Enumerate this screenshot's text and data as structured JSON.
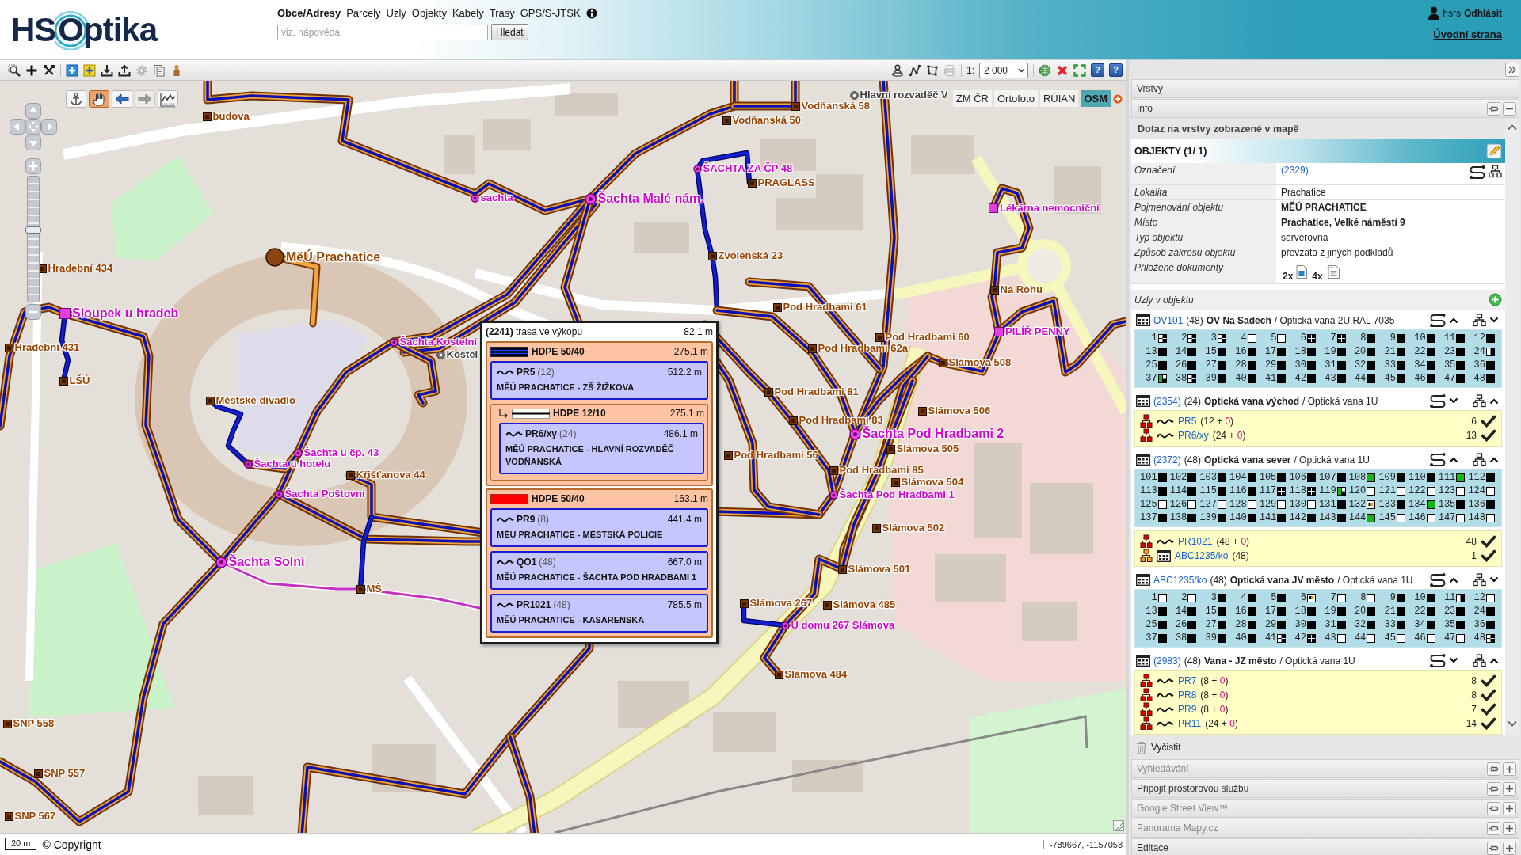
{
  "header": {
    "logo": {
      "initials": "HS",
      "name": "Optika"
    },
    "search_tabs": [
      {
        "label": "Obce/Adresy",
        "selected": true
      },
      {
        "label": "Parcely",
        "selected": false
      },
      {
        "label": "Uzly",
        "selected": false
      },
      {
        "label": "Objekty",
        "selected": false
      },
      {
        "label": "Kabely",
        "selected": false
      },
      {
        "label": "Trasy",
        "selected": false
      },
      {
        "label": "GPS/S-JTSK",
        "selected": false
      }
    ],
    "search": {
      "placeholder": "viz. nápověda",
      "button": "Hledat"
    },
    "user": {
      "name": "hsrs",
      "logout": "Odhlásit"
    },
    "home_link": "Úvodní strana"
  },
  "toolbar": {
    "left_tools": [
      {
        "kind": "zoom-box",
        "disabled": false
      },
      {
        "kind": "add",
        "disabled": false
      },
      {
        "kind": "tools",
        "disabled": false
      },
      {
        "kind": "add-blue",
        "disabled": false
      },
      {
        "kind": "add-yellow",
        "disabled": false
      },
      {
        "kind": "import",
        "disabled": false
      },
      {
        "kind": "export",
        "disabled": false
      },
      {
        "kind": "settings",
        "disabled": true
      },
      {
        "kind": "document",
        "disabled": false
      },
      {
        "kind": "person",
        "disabled": false
      }
    ],
    "right_tools": [
      {
        "kind": "user-pin",
        "disabled": false
      },
      {
        "kind": "route",
        "disabled": false
      },
      {
        "kind": "polygon",
        "disabled": false
      },
      {
        "kind": "print",
        "disabled": true
      }
    ],
    "scale_prefix": "1:",
    "scale": "2 000",
    "view_tools": [
      {
        "kind": "globe"
      },
      {
        "kind": "close"
      },
      {
        "kind": "fullscreen"
      },
      {
        "kind": "help",
        "label": "?"
      },
      {
        "kind": "help",
        "label": "?"
      }
    ]
  },
  "map": {
    "tools": [
      {
        "kind": "anchor",
        "selected": false,
        "disabled": false
      },
      {
        "kind": "pan",
        "selected": true,
        "disabled": false
      },
      {
        "kind": "back",
        "selected": false,
        "disabled": false
      },
      {
        "kind": "forward",
        "selected": false,
        "disabled": true
      },
      {
        "kind": "profile",
        "selected": false,
        "disabled": false
      }
    ],
    "zoom_slider": {
      "level": 0.58
    },
    "layers": [
      {
        "label": "ZM ČR",
        "selected": false
      },
      {
        "label": "Ortofoto",
        "selected": false
      },
      {
        "label": "RÚIAN",
        "selected": false
      },
      {
        "label": "OSM",
        "selected": true
      }
    ],
    "nodes": [
      {
        "label": "Hlavní rozvaděč V",
        "kind": "other",
        "large": false
      },
      {
        "label": "Vodňanská 58",
        "kind": "object",
        "large": false
      },
      {
        "label": "budova",
        "kind": "object",
        "large": false
      },
      {
        "label": "Vodňanská 50",
        "kind": "object",
        "large": false
      },
      {
        "label": "ŠACHTA ZA ČP 48",
        "kind": "shaft",
        "large": false
      },
      {
        "label": "PRAGLASS",
        "kind": "object",
        "large": false
      },
      {
        "label": "sachta",
        "kind": "shaft",
        "large": false
      },
      {
        "label": "Šachta Malé nám.",
        "kind": "shaft",
        "large": true
      },
      {
        "label": "Lékárna nemocniční",
        "kind": "point",
        "large": false
      },
      {
        "label": "MěÚ Prachatice",
        "kind": "building",
        "large": true
      },
      {
        "label": "Zvolenská 23",
        "kind": "object",
        "large": false
      },
      {
        "label": "Hradební 434",
        "kind": "object",
        "large": false
      },
      {
        "label": "Na Rohu",
        "kind": "object",
        "large": false
      },
      {
        "label": "Pod Hradbami 61",
        "kind": "object",
        "large": false
      },
      {
        "label": "Sloupek u hradeb",
        "kind": "point",
        "large": true
      },
      {
        "label": "PILÍŘ PENNY",
        "kind": "point",
        "large": false
      },
      {
        "label": "Pod Hradbami 60",
        "kind": "object",
        "large": false
      },
      {
        "label": "Šachta Kostelní",
        "kind": "shaft",
        "large": false
      },
      {
        "label": "Hradební 431",
        "kind": "object",
        "large": false
      },
      {
        "label": "Pod Hradbami 62a",
        "kind": "object",
        "large": false
      },
      {
        "label": "Kostel",
        "kind": "other",
        "large": false
      },
      {
        "label": "Slámova 508",
        "kind": "object",
        "large": false
      },
      {
        "label": "LŠÚ",
        "kind": "object",
        "large": false
      },
      {
        "label": "Pod Hradbami 81",
        "kind": "object",
        "large": false
      },
      {
        "label": "Městské divadlo",
        "kind": "object",
        "large": false
      },
      {
        "label": "Slámova 506",
        "kind": "object",
        "large": false
      },
      {
        "label": "Pod Hradbami 83",
        "kind": "object",
        "large": false
      },
      {
        "label": "Šachta Pod Hradbami 2",
        "kind": "shaft",
        "large": true
      },
      {
        "label": "Slámova 505",
        "kind": "object",
        "large": false
      },
      {
        "label": "Šachta u čp. 43",
        "kind": "shaft",
        "large": false
      },
      {
        "label": "Pod Hradbami 56",
        "kind": "object",
        "large": false
      },
      {
        "label": "Šachta u hotelu",
        "kind": "shaft",
        "large": false
      },
      {
        "label": "Pod Hradbami 85",
        "kind": "object",
        "large": false
      },
      {
        "label": "Křišťanova 44",
        "kind": "object",
        "large": false
      },
      {
        "label": "Slámova 504",
        "kind": "object",
        "large": false
      },
      {
        "label": "Šachta Poštovní",
        "kind": "shaft",
        "large": false
      },
      {
        "label": "Šachta Pod Hradbami 1",
        "kind": "shaft",
        "large": false
      },
      {
        "label": "Slámova 502",
        "kind": "object",
        "large": false
      },
      {
        "label": "Šachta Solní",
        "kind": "shaft",
        "large": true
      },
      {
        "label": "Slámova 501",
        "kind": "object",
        "large": false
      },
      {
        "label": "MŠ",
        "kind": "object",
        "large": false
      },
      {
        "label": "Slámova 267",
        "kind": "object",
        "large": false
      },
      {
        "label": "Slámova 485",
        "kind": "object",
        "large": false
      },
      {
        "label": "U domu 267 Slámova",
        "kind": "shaft",
        "large": false
      },
      {
        "label": "Slámova 484",
        "kind": "object",
        "large": false
      },
      {
        "label": "SNP 558",
        "kind": "object",
        "large": false
      },
      {
        "label": "SNP 557",
        "kind": "object",
        "large": false
      },
      {
        "label": "SNP 567",
        "kind": "object",
        "large": false
      }
    ],
    "popup": {
      "title": "**(2241)** trasa ve výkopu",
      "length": "82.1 m",
      "ducts": [
        {
          "name": "HDPE 50/40",
          "length": "275.1 m",
          "color": "#000000",
          "striped": true,
          "cables": [
            {
              "name": "PR5",
              "fibers": "(12)",
              "length": "512.2 m",
              "route": "MĚÚ PRACHATICE - ZŠ ŽIŽKOVA"
            }
          ],
          "subducts": [
            {
              "name": "HDPE 12/10",
              "length": "275.1 m",
              "color": "#ffffff",
              "cables": [
                {
                  "name": "PR6/xy",
                  "fibers": "(24)",
                  "length": "486.1 m",
                  "route": "MĚÚ PRACHATICE - HLAVNÍ ROZVADĚČ VODŇANSKÁ"
                }
              ]
            }
          ]
        },
        {
          "name": "HDPE 50/40",
          "length": "163.1 m",
          "color": "#ff0000",
          "striped": false,
          "cables": [
            {
              "name": "PR9",
              "fibers": "(8)",
              "length": "441.4 m",
              "route": "MĚÚ PRACHATICE - MĚSTSKÁ POLICIE"
            },
            {
              "name": "QO1",
              "fibers": "(48)",
              "length": "667.0 m",
              "route": "MĚÚ PRACHATICE - ŠACHTA POD HRADBAMI 1"
            },
            {
              "name": "PR1021",
              "fibers": "(48)",
              "length": "785.5 m",
              "route": "MĚÚ PRACHATICE - KASARENSKA"
            }
          ]
        }
      ]
    },
    "scale_label": "20 m",
    "copyright": "© Copyright",
    "coordinates": "-789667, -1157053"
  },
  "panel": {
    "layers_title": "Vrstvy",
    "info": {
      "title": "Info",
      "expanded": true
    },
    "query_title": "Dotaz na vrstvy zobrazené v mapě",
    "objects": {
      "title": "OBJEKTY (1/ 1)",
      "properties": [
        {
          "label": "Označení",
          "kind": "link",
          "value": "(2329)"
        },
        {
          "label": "Lokalita",
          "kind": "text",
          "value": "Prachatice"
        },
        {
          "label": "Pojmenování objektu",
          "kind": "bold",
          "value": "MĚÚ PRACHATICE"
        },
        {
          "label": "Místo",
          "kind": "bold",
          "value": "Prachatice, Velké náměstí 9"
        },
        {
          "label": "Typ objektu",
          "kind": "text",
          "value": "serverovna"
        },
        {
          "label": "Způsob zákresu objektu",
          "kind": "text",
          "value": "převzato z jiných podkladů"
        },
        {
          "label": "Přiložené dokumenty",
          "kind": "documents",
          "documents": [
            {
              "count": "2x",
              "kind": "image"
            },
            {
              "count": "4x",
              "kind": "text"
            }
          ]
        }
      ]
    },
    "nodes_title": "Uzly v objektu",
    "nodes": [
      {
        "link": "OV101",
        "ports_count": "(48)",
        "name": "OV Na Sadech",
        "type": "/ Optická vana 2U RAL 7035",
        "ports_expanded": true,
        "cables_expanded": false,
        "ports": [
          {
            "number": "1",
            "kind": "half"
          },
          {
            "number": "2",
            "kind": "half"
          },
          {
            "number": "3",
            "kind": "half"
          },
          {
            "number": "4",
            "kind": "empty"
          },
          {
            "number": "5",
            "kind": "empty"
          },
          {
            "number": "6",
            "kind": "quad"
          },
          {
            "number": "7",
            "kind": "quad"
          },
          {
            "number": "8",
            "kind": "full"
          },
          {
            "number": "9",
            "kind": "full"
          },
          {
            "number": "10",
            "kind": "full"
          },
          {
            "number": "11",
            "kind": "full"
          },
          {
            "number": "12",
            "kind": "full"
          },
          {
            "number": "13",
            "kind": "full"
          },
          {
            "number": "14",
            "kind": "full"
          },
          {
            "number": "15",
            "kind": "full"
          },
          {
            "number": "16",
            "kind": "full"
          },
          {
            "number": "17",
            "kind": "full"
          },
          {
            "number": "18",
            "kind": "full"
          },
          {
            "number": "19",
            "kind": "full"
          },
          {
            "number": "20",
            "kind": "full"
          },
          {
            "number": "21",
            "kind": "full"
          },
          {
            "number": "22",
            "kind": "full"
          },
          {
            "number": "23",
            "kind": "full"
          },
          {
            "number": "24",
            "kind": "half"
          },
          {
            "number": "25",
            "kind": "full"
          },
          {
            "number": "26",
            "kind": "full"
          },
          {
            "number": "27",
            "kind": "full"
          },
          {
            "number": "28",
            "kind": "full"
          },
          {
            "number": "29",
            "kind": "full"
          },
          {
            "number": "30",
            "kind": "full"
          },
          {
            "number": "31",
            "kind": "full"
          },
          {
            "number": "32",
            "kind": "full"
          },
          {
            "number": "33",
            "kind": "full"
          },
          {
            "number": "34",
            "kind": "full"
          },
          {
            "number": "35",
            "kind": "full"
          },
          {
            "number": "36",
            "kind": "full"
          },
          {
            "number": "37",
            "kind": "half-green"
          },
          {
            "number": "38",
            "kind": "half"
          },
          {
            "number": "39",
            "kind": "full"
          },
          {
            "number": "40",
            "kind": "full"
          },
          {
            "number": "41",
            "kind": "full"
          },
          {
            "number": "42",
            "kind": "full"
          },
          {
            "number": "43",
            "kind": "full"
          },
          {
            "number": "44",
            "kind": "full"
          },
          {
            "number": "45",
            "kind": "full"
          },
          {
            "number": "46",
            "kind": "full"
          },
          {
            "number": "47",
            "kind": "full"
          },
          {
            "number": "48",
            "kind": "full"
          }
        ]
      },
      {
        "link": "(2354)",
        "ports_count": "(24)",
        "name": "Optická vana východ",
        "type": "/ Optická vana 1U",
        "ports_expanded": false,
        "cables_expanded": true,
        "cables": [
          {
            "kind": "cable",
            "link": "PR5",
            "capacity": "(12 + ",
            "spare": "0",
            "suffix": ")",
            "used": "6",
            "checked": true
          },
          {
            "kind": "cable",
            "link": "PR6/xy",
            "capacity": "(24 + ",
            "spare": "0",
            "suffix": ")",
            "used": "13",
            "checked": true
          }
        ]
      },
      {
        "link": "(2372)",
        "ports_count": "(48)",
        "name": "Optická vana sever",
        "type": "/ Optická vana 1U",
        "ports_expanded": true,
        "cables_expanded": true,
        "ports": [
          {
            "number": "101",
            "kind": "full"
          },
          {
            "number": "102",
            "kind": "full"
          },
          {
            "number": "103",
            "kind": "full"
          },
          {
            "number": "104",
            "kind": "full"
          },
          {
            "number": "105",
            "kind": "full"
          },
          {
            "number": "106",
            "kind": "full"
          },
          {
            "number": "107",
            "kind": "full"
          },
          {
            "number": "108",
            "kind": "green"
          },
          {
            "number": "109",
            "kind": "full"
          },
          {
            "number": "110",
            "kind": "full"
          },
          {
            "number": "111",
            "kind": "green"
          },
          {
            "number": "112",
            "kind": "full"
          },
          {
            "number": "113",
            "kind": "full"
          },
          {
            "number": "114",
            "kind": "full"
          },
          {
            "number": "115",
            "kind": "full"
          },
          {
            "number": "116",
            "kind": "full"
          },
          {
            "number": "117",
            "kind": "quad"
          },
          {
            "number": "118",
            "kind": "quad"
          },
          {
            "number": "119",
            "kind": "half-green"
          },
          {
            "number": "120",
            "kind": "empty"
          },
          {
            "number": "121",
            "kind": "empty"
          },
          {
            "number": "122",
            "kind": "empty"
          },
          {
            "number": "123",
            "kind": "empty"
          },
          {
            "number": "124",
            "kind": "empty"
          },
          {
            "number": "125",
            "kind": "empty"
          },
          {
            "number": "126",
            "kind": "empty"
          },
          {
            "number": "127",
            "kind": "empty"
          },
          {
            "number": "128",
            "kind": "empty"
          },
          {
            "number": "129",
            "kind": "empty"
          },
          {
            "number": "130",
            "kind": "empty"
          },
          {
            "number": "131",
            "kind": "full"
          },
          {
            "number": "132",
            "kind": "reserved"
          },
          {
            "number": "133",
            "kind": "full"
          },
          {
            "number": "134",
            "kind": "green"
          },
          {
            "number": "135",
            "kind": "full"
          },
          {
            "number": "136",
            "kind": "full"
          },
          {
            "number": "137",
            "kind": "full"
          },
          {
            "number": "138",
            "kind": "full"
          },
          {
            "number": "139",
            "kind": "full"
          },
          {
            "number": "140",
            "kind": "full"
          },
          {
            "number": "141",
            "kind": "full"
          },
          {
            "number": "142",
            "kind": "full"
          },
          {
            "number": "143",
            "kind": "full"
          },
          {
            "number": "144",
            "kind": "green"
          },
          {
            "number": "145",
            "kind": "empty"
          },
          {
            "number": "146",
            "kind": "empty"
          },
          {
            "number": "147",
            "kind": "empty"
          },
          {
            "number": "148",
            "kind": "empty"
          }
        ],
        "cables": [
          {
            "kind": "cable",
            "link": "PR1021",
            "capacity": "(48 + ",
            "spare": "0",
            "suffix": ")",
            "used": "48",
            "checked": true
          },
          {
            "kind": "node",
            "link": "ABC1235/ko",
            "capacity": "(48)",
            "used": "1",
            "checked": true
          }
        ]
      },
      {
        "link": "ABC1235/ko",
        "ports_count": "(48)",
        "name": "Optická vana JV město",
        "type": "/ Optická vana 1U",
        "ports_expanded": true,
        "cables_expanded": false,
        "ports": [
          {
            "number": "1",
            "kind": "empty"
          },
          {
            "number": "2",
            "kind": "empty"
          },
          {
            "number": "3",
            "kind": "full"
          },
          {
            "number": "4",
            "kind": "full"
          },
          {
            "number": "5",
            "kind": "full"
          },
          {
            "number": "6",
            "kind": "reserved"
          },
          {
            "number": "7",
            "kind": "empty"
          },
          {
            "number": "8",
            "kind": "empty"
          },
          {
            "number": "9",
            "kind": "full"
          },
          {
            "number": "10",
            "kind": "full"
          },
          {
            "number": "11",
            "kind": "half"
          },
          {
            "number": "12",
            "kind": "empty"
          },
          {
            "number": "13",
            "kind": "full"
          },
          {
            "number": "14",
            "kind": "full"
          },
          {
            "number": "15",
            "kind": "full"
          },
          {
            "number": "16",
            "kind": "full"
          },
          {
            "number": "17",
            "kind": "full"
          },
          {
            "number": "18",
            "kind": "full"
          },
          {
            "number": "19",
            "kind": "full"
          },
          {
            "number": "20",
            "kind": "full"
          },
          {
            "number": "21",
            "kind": "full"
          },
          {
            "number": "22",
            "kind": "full"
          },
          {
            "number": "23",
            "kind": "full"
          },
          {
            "number": "24",
            "kind": "full"
          },
          {
            "number": "25",
            "kind": "full"
          },
          {
            "number": "26",
            "kind": "full"
          },
          {
            "number": "27",
            "kind": "full"
          },
          {
            "number": "28",
            "kind": "full"
          },
          {
            "number": "29",
            "kind": "full"
          },
          {
            "number": "30",
            "kind": "full"
          },
          {
            "number": "31",
            "kind": "full"
          },
          {
            "number": "32",
            "kind": "full"
          },
          {
            "number": "33",
            "kind": "full"
          },
          {
            "number": "34",
            "kind": "full"
          },
          {
            "number": "35",
            "kind": "full"
          },
          {
            "number": "36",
            "kind": "full"
          },
          {
            "number": "37",
            "kind": "full"
          },
          {
            "number": "38",
            "kind": "full"
          },
          {
            "number": "39",
            "kind": "full"
          },
          {
            "number": "40",
            "kind": "full"
          },
          {
            "number": "41",
            "kind": "half"
          },
          {
            "number": "42",
            "kind": "quad"
          },
          {
            "number": "43",
            "kind": "empty"
          },
          {
            "number": "44",
            "kind": "empty"
          },
          {
            "number": "45",
            "kind": "empty"
          },
          {
            "number": "46",
            "kind": "empty"
          },
          {
            "number": "47",
            "kind": "empty"
          },
          {
            "number": "48",
            "kind": "half"
          }
        ]
      },
      {
        "link": "(2983)",
        "ports_count": "(48)",
        "name": "Vana - JZ město",
        "type": "/ Optická vana 1U",
        "ports_expanded": false,
        "cables_expanded": true,
        "cables": [
          {
            "kind": "cable",
            "link": "PR7",
            "capacity": "(8 + ",
            "spare": "0",
            "suffix": ")",
            "used": "8",
            "checked": true
          },
          {
            "kind": "cable",
            "link": "PR8",
            "capacity": "(8 + ",
            "spare": "0",
            "suffix": ")",
            "used": "8",
            "checked": true
          },
          {
            "kind": "cable",
            "link": "PR9",
            "capacity": "(8 + ",
            "spare": "0",
            "suffix": ")",
            "used": "7",
            "checked": true
          },
          {
            "kind": "cable",
            "link": "PR11",
            "capacity": "(24 + ",
            "spare": "0",
            "suffix": ")",
            "used": "14",
            "checked": true
          }
        ]
      }
    ],
    "clear_button": "Vyčistit",
    "sections": [
      {
        "title": "Vyhledávání",
        "disabled": true
      },
      {
        "title": "Připojit prostorovou službu",
        "disabled": false
      },
      {
        "title": "Google Street View™",
        "disabled": true
      },
      {
        "title": "Panorama Mapy.cz",
        "disabled": true
      },
      {
        "title": "Editace",
        "disabled": false
      }
    ]
  }
}
